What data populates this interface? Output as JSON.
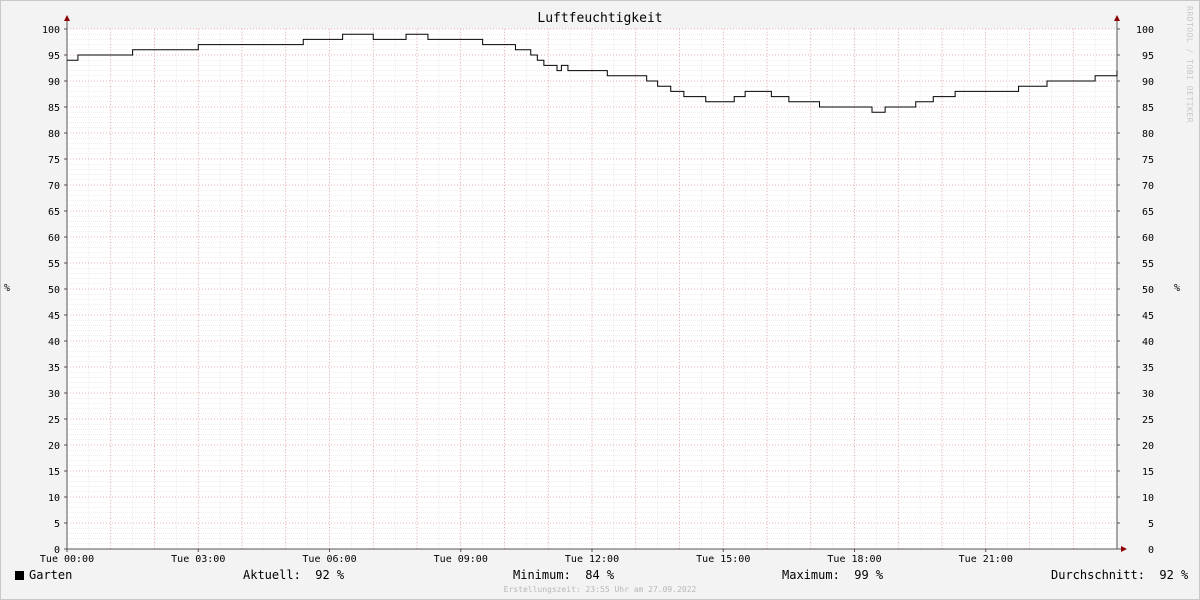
{
  "chart_data": {
    "type": "line",
    "title": "Luftfeuchtigkeit",
    "ylabel": "%",
    "ylim": [
      0,
      100
    ],
    "yticks": [
      0,
      5,
      10,
      15,
      20,
      25,
      30,
      35,
      40,
      45,
      50,
      55,
      60,
      65,
      70,
      75,
      80,
      85,
      90,
      95,
      100
    ],
    "xlim": [
      0,
      24
    ],
    "xticks": [
      {
        "h": 0,
        "label": "Tue 00:00"
      },
      {
        "h": 3,
        "label": "Tue 03:00"
      },
      {
        "h": 6,
        "label": "Tue 06:00"
      },
      {
        "h": 9,
        "label": "Tue 09:00"
      },
      {
        "h": 12,
        "label": "Tue 12:00"
      },
      {
        "h": 15,
        "label": "Tue 15:00"
      },
      {
        "h": 18,
        "label": "Tue 18:00"
      },
      {
        "h": 21,
        "label": "Tue 21:00"
      }
    ],
    "grid": true,
    "series": [
      {
        "name": "Garten",
        "color": "#000000",
        "x": [
          0,
          0.25,
          1.5,
          3,
          5.4,
          6.3,
          7,
          7.75,
          8.25,
          8.8,
          9.5,
          10.25,
          10.6,
          10.75,
          10.9,
          11.2,
          11.3,
          11.45,
          11.9,
          12.35,
          13.25,
          13.5,
          13.8,
          14.1,
          14.6,
          15.25,
          15.5,
          16.1,
          16.5,
          17.2,
          18.4,
          18.7,
          19.1,
          19.4,
          19.8,
          20.3,
          21.75,
          22.4,
          23.5,
          24
        ],
        "y": [
          94,
          95,
          96,
          97,
          98,
          99,
          98,
          99,
          98,
          98,
          97,
          96,
          95,
          94,
          93,
          92,
          93,
          92,
          92,
          91,
          90,
          89,
          88,
          87,
          86,
          87,
          88,
          87,
          86,
          85,
          84,
          85,
          85,
          86,
          87,
          88,
          89,
          90,
          91,
          92
        ]
      }
    ]
  },
  "legend": {
    "series_name": "Garten",
    "aktuell": "Aktuell:  92 %",
    "minimum": "Minimum:  84 %",
    "maximum": "Maximum:  99 %",
    "durchschnitt": "Durchschnitt:  92 %"
  },
  "watermark": "RRDTOOL / TOBI OETIKER",
  "footer": "Erstellungszeit: 23:55 Uhr am 27.09.2022",
  "colors": {
    "minor_grid": "#dcdcdc",
    "major_grid": "#e89a9a",
    "axis": "#555555",
    "arrow": "#8b0000",
    "line": "#000000"
  }
}
